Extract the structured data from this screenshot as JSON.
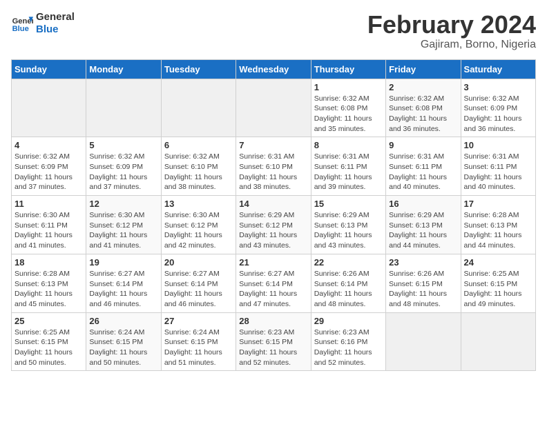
{
  "header": {
    "logo_line1": "General",
    "logo_line2": "Blue",
    "title": "February 2024",
    "subtitle": "Gajiram, Borno, Nigeria"
  },
  "days_of_week": [
    "Sunday",
    "Monday",
    "Tuesday",
    "Wednesday",
    "Thursday",
    "Friday",
    "Saturday"
  ],
  "weeks": [
    [
      {
        "day": "",
        "info": ""
      },
      {
        "day": "",
        "info": ""
      },
      {
        "day": "",
        "info": ""
      },
      {
        "day": "",
        "info": ""
      },
      {
        "day": "1",
        "info": "Sunrise: 6:32 AM\nSunset: 6:08 PM\nDaylight: 11 hours and 35 minutes."
      },
      {
        "day": "2",
        "info": "Sunrise: 6:32 AM\nSunset: 6:08 PM\nDaylight: 11 hours and 36 minutes."
      },
      {
        "day": "3",
        "info": "Sunrise: 6:32 AM\nSunset: 6:09 PM\nDaylight: 11 hours and 36 minutes."
      }
    ],
    [
      {
        "day": "4",
        "info": "Sunrise: 6:32 AM\nSunset: 6:09 PM\nDaylight: 11 hours and 37 minutes."
      },
      {
        "day": "5",
        "info": "Sunrise: 6:32 AM\nSunset: 6:09 PM\nDaylight: 11 hours and 37 minutes."
      },
      {
        "day": "6",
        "info": "Sunrise: 6:32 AM\nSunset: 6:10 PM\nDaylight: 11 hours and 38 minutes."
      },
      {
        "day": "7",
        "info": "Sunrise: 6:31 AM\nSunset: 6:10 PM\nDaylight: 11 hours and 38 minutes."
      },
      {
        "day": "8",
        "info": "Sunrise: 6:31 AM\nSunset: 6:11 PM\nDaylight: 11 hours and 39 minutes."
      },
      {
        "day": "9",
        "info": "Sunrise: 6:31 AM\nSunset: 6:11 PM\nDaylight: 11 hours and 40 minutes."
      },
      {
        "day": "10",
        "info": "Sunrise: 6:31 AM\nSunset: 6:11 PM\nDaylight: 11 hours and 40 minutes."
      }
    ],
    [
      {
        "day": "11",
        "info": "Sunrise: 6:30 AM\nSunset: 6:11 PM\nDaylight: 11 hours and 41 minutes."
      },
      {
        "day": "12",
        "info": "Sunrise: 6:30 AM\nSunset: 6:12 PM\nDaylight: 11 hours and 41 minutes."
      },
      {
        "day": "13",
        "info": "Sunrise: 6:30 AM\nSunset: 6:12 PM\nDaylight: 11 hours and 42 minutes."
      },
      {
        "day": "14",
        "info": "Sunrise: 6:29 AM\nSunset: 6:12 PM\nDaylight: 11 hours and 43 minutes."
      },
      {
        "day": "15",
        "info": "Sunrise: 6:29 AM\nSunset: 6:13 PM\nDaylight: 11 hours and 43 minutes."
      },
      {
        "day": "16",
        "info": "Sunrise: 6:29 AM\nSunset: 6:13 PM\nDaylight: 11 hours and 44 minutes."
      },
      {
        "day": "17",
        "info": "Sunrise: 6:28 AM\nSunset: 6:13 PM\nDaylight: 11 hours and 44 minutes."
      }
    ],
    [
      {
        "day": "18",
        "info": "Sunrise: 6:28 AM\nSunset: 6:13 PM\nDaylight: 11 hours and 45 minutes."
      },
      {
        "day": "19",
        "info": "Sunrise: 6:27 AM\nSunset: 6:14 PM\nDaylight: 11 hours and 46 minutes."
      },
      {
        "day": "20",
        "info": "Sunrise: 6:27 AM\nSunset: 6:14 PM\nDaylight: 11 hours and 46 minutes."
      },
      {
        "day": "21",
        "info": "Sunrise: 6:27 AM\nSunset: 6:14 PM\nDaylight: 11 hours and 47 minutes."
      },
      {
        "day": "22",
        "info": "Sunrise: 6:26 AM\nSunset: 6:14 PM\nDaylight: 11 hours and 48 minutes."
      },
      {
        "day": "23",
        "info": "Sunrise: 6:26 AM\nSunset: 6:15 PM\nDaylight: 11 hours and 48 minutes."
      },
      {
        "day": "24",
        "info": "Sunrise: 6:25 AM\nSunset: 6:15 PM\nDaylight: 11 hours and 49 minutes."
      }
    ],
    [
      {
        "day": "25",
        "info": "Sunrise: 6:25 AM\nSunset: 6:15 PM\nDaylight: 11 hours and 50 minutes."
      },
      {
        "day": "26",
        "info": "Sunrise: 6:24 AM\nSunset: 6:15 PM\nDaylight: 11 hours and 50 minutes."
      },
      {
        "day": "27",
        "info": "Sunrise: 6:24 AM\nSunset: 6:15 PM\nDaylight: 11 hours and 51 minutes."
      },
      {
        "day": "28",
        "info": "Sunrise: 6:23 AM\nSunset: 6:15 PM\nDaylight: 11 hours and 52 minutes."
      },
      {
        "day": "29",
        "info": "Sunrise: 6:23 AM\nSunset: 6:16 PM\nDaylight: 11 hours and 52 minutes."
      },
      {
        "day": "",
        "info": ""
      },
      {
        "day": "",
        "info": ""
      }
    ]
  ]
}
